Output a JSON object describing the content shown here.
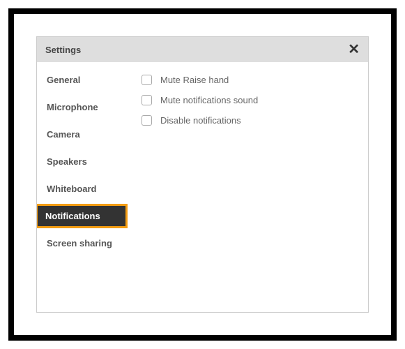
{
  "dialog": {
    "title": "Settings"
  },
  "sidebar": {
    "items": [
      {
        "label": "General",
        "active": false
      },
      {
        "label": "Microphone",
        "active": false
      },
      {
        "label": "Camera",
        "active": false
      },
      {
        "label": "Speakers",
        "active": false
      },
      {
        "label": "Whiteboard",
        "active": false
      },
      {
        "label": "Notifications",
        "active": true
      },
      {
        "label": "Screen sharing",
        "active": false
      }
    ]
  },
  "content": {
    "options": [
      {
        "label": "Mute Raise hand",
        "checked": false
      },
      {
        "label": "Mute notifications sound",
        "checked": false
      },
      {
        "label": "Disable notifications",
        "checked": false
      }
    ]
  }
}
